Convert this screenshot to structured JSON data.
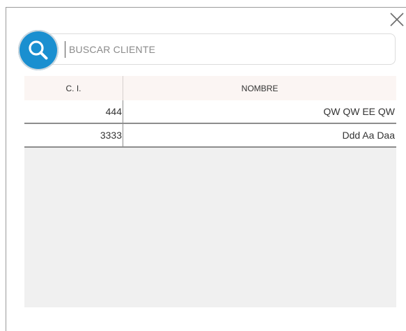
{
  "dialog": {
    "close_icon": "close-icon"
  },
  "search": {
    "placeholder": "BUSCAR CLIENTE",
    "value": "",
    "icon": "search-icon",
    "accent_color": "#1a8fd0"
  },
  "table": {
    "columns": [
      "C. I.",
      "NOMBRE"
    ],
    "rows": [
      {
        "ci": "444",
        "nombre": "QW QW EE QW"
      },
      {
        "ci": "3333",
        "nombre": "Ddd Aa Daa"
      }
    ]
  }
}
